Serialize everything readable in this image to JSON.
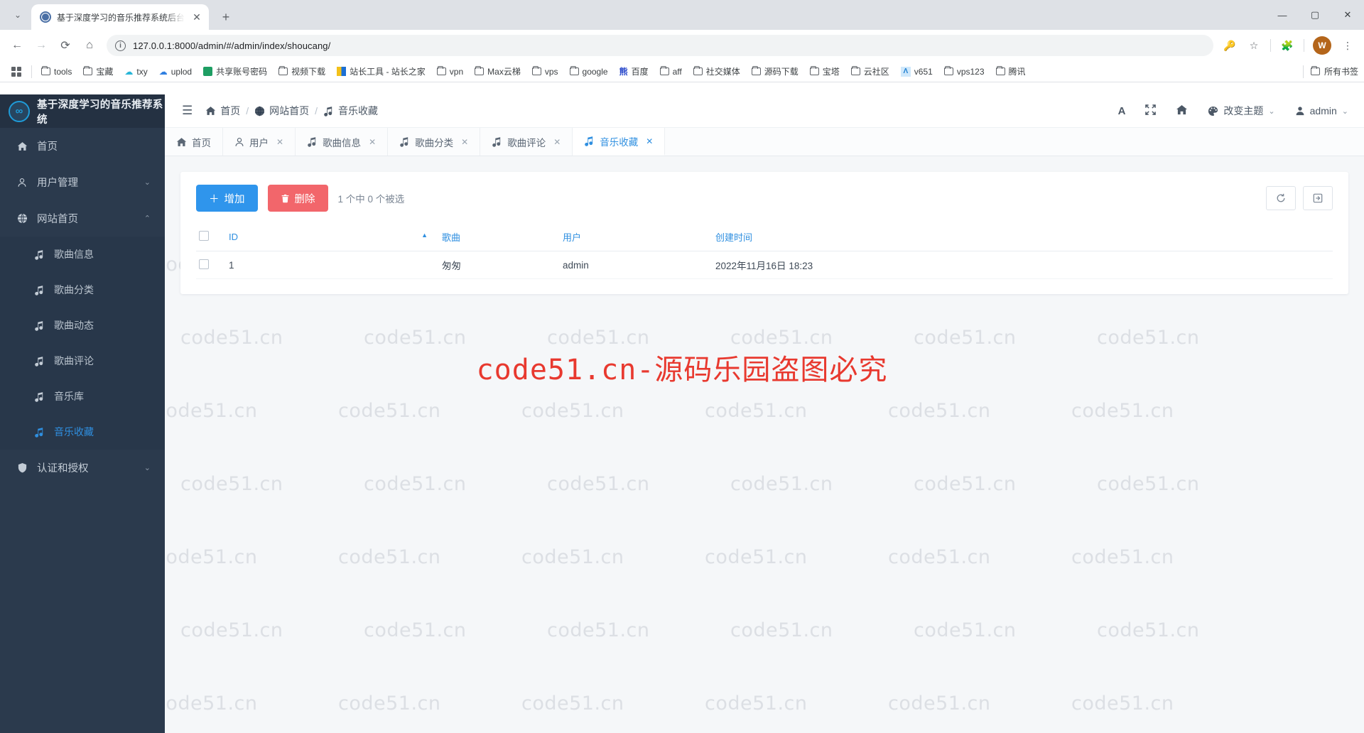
{
  "browser": {
    "tab": {
      "title": "基于深度学习的音乐推荐系统后台",
      "close_label": "✕",
      "favicon": "globe-icon"
    },
    "new_tab_label": "+",
    "tab_list_label": "⌄",
    "window_controls": {
      "minimize": "—",
      "maximize": "▢",
      "close": "✕"
    },
    "nav": {
      "back": "←",
      "forward": "→",
      "reload": "⟳",
      "home": "⌂"
    },
    "omnibox": {
      "url": "127.0.0.1:8000/admin/#/admin/index/shoucang/",
      "info_icon": "ⓘ"
    },
    "toolbar_right": {
      "key_icon": "🔑",
      "star_icon": "☆",
      "extensions_icon": "🧩",
      "profile_initial": "W",
      "menu_icon": "⋮"
    },
    "bookmarks": [
      {
        "label": "tools",
        "icon": "folder-icon"
      },
      {
        "label": "宝藏",
        "icon": "folder-icon"
      },
      {
        "label": "txy",
        "icon": "cloud-icon"
      },
      {
        "label": "uplod",
        "icon": "cloud-upload-icon"
      },
      {
        "label": "共享账号密码",
        "icon": "sheets-icon"
      },
      {
        "label": "视频下载",
        "icon": "folder-icon"
      },
      {
        "label": "站长工具 - 站长之家",
        "icon": "chinaz-icon"
      },
      {
        "label": "vpn",
        "icon": "folder-icon"
      },
      {
        "label": "Max云梯",
        "icon": "folder-icon"
      },
      {
        "label": "vps",
        "icon": "folder-icon"
      },
      {
        "label": "google",
        "icon": "folder-icon"
      },
      {
        "label": "百度",
        "icon": "baidu-icon"
      },
      {
        "label": "aff",
        "icon": "folder-icon"
      },
      {
        "label": "社交媒体",
        "icon": "folder-icon"
      },
      {
        "label": "源码下载",
        "icon": "folder-icon"
      },
      {
        "label": "宝塔",
        "icon": "folder-icon"
      },
      {
        "label": "云社区",
        "icon": "folder-icon"
      },
      {
        "label": "v651",
        "icon": "v2ex-icon"
      },
      {
        "label": "vps123",
        "icon": "folder-icon"
      },
      {
        "label": "腾讯",
        "icon": "folder-icon"
      }
    ],
    "all_bookmarks_label": "所有书签"
  },
  "app": {
    "brand": {
      "name": "基于深度学习的音乐推荐系统",
      "logo": "infinity-icon"
    },
    "hamburger_icon": "☰",
    "breadcrumb": [
      {
        "label": "首页",
        "icon": "home-icon"
      },
      {
        "label": "网站首页",
        "icon": "globe-icon"
      },
      {
        "label": "音乐收藏",
        "icon": "music-note-icon"
      }
    ],
    "breadcrumb_separator": "/",
    "header_actions": {
      "font_icon": "A",
      "fullscreen_icon": "⤢",
      "home_icon": "home-icon",
      "theme_icon": "palette-icon",
      "theme_label": "改变主题",
      "theme_caret": "⌄",
      "user_icon": "user-icon",
      "user_label": "admin",
      "user_caret": "⌄"
    },
    "sidebar": [
      {
        "label": "首页",
        "icon": "home-icon",
        "type": "item",
        "active": false
      },
      {
        "label": "用户管理",
        "icon": "user-icon",
        "type": "group",
        "caret": "⌄",
        "open": false
      },
      {
        "label": "网站首页",
        "icon": "globe-icon",
        "type": "group",
        "caret": "⌃",
        "open": true,
        "children": [
          {
            "label": "歌曲信息",
            "icon": "music-note-icon",
            "active": false
          },
          {
            "label": "歌曲分类",
            "icon": "music-note-icon",
            "active": false
          },
          {
            "label": "歌曲动态",
            "icon": "music-note-icon",
            "active": false
          },
          {
            "label": "歌曲评论",
            "icon": "music-note-icon",
            "active": false
          },
          {
            "label": "音乐库",
            "icon": "music-note-icon",
            "active": false
          },
          {
            "label": "音乐收藏",
            "icon": "music-note-icon",
            "active": true
          }
        ]
      },
      {
        "label": "认证和授权",
        "icon": "shield-icon",
        "type": "group",
        "caret": "⌄",
        "open": false
      }
    ],
    "view_tabs": [
      {
        "label": "首页",
        "icon": "home-icon",
        "closable": false,
        "active": false
      },
      {
        "label": "用户",
        "icon": "user-icon",
        "closable": true,
        "active": false
      },
      {
        "label": "歌曲信息",
        "icon": "music-note-icon",
        "closable": true,
        "active": false
      },
      {
        "label": "歌曲分类",
        "icon": "music-note-icon",
        "closable": true,
        "active": false
      },
      {
        "label": "歌曲评论",
        "icon": "music-note-icon",
        "closable": true,
        "active": false
      },
      {
        "label": "音乐收藏",
        "icon": "music-note-icon",
        "closable": true,
        "active": true
      }
    ],
    "tab_close_glyph": "✕",
    "toolbar": {
      "add_label": "增加",
      "add_icon": "plus-icon",
      "delete_label": "删除",
      "delete_icon": "trash-icon",
      "selection_text": "1 个中 0 个被选",
      "refresh_icon": "refresh-icon",
      "export_icon": "export-icon"
    },
    "table": {
      "columns": [
        "ID",
        "歌曲",
        "用户",
        "创建时间"
      ],
      "sorted_column": "ID",
      "sort_caret": "▲",
      "rows": [
        {
          "id": "1",
          "song": "匆匆",
          "user": "admin",
          "created": "2022年11月16日 18:23"
        }
      ]
    }
  },
  "watermark": {
    "tile_text": "code51.cn",
    "banner_text": "code51.cn-源码乐园盗图必究",
    "banner_color": "#e8392f"
  }
}
